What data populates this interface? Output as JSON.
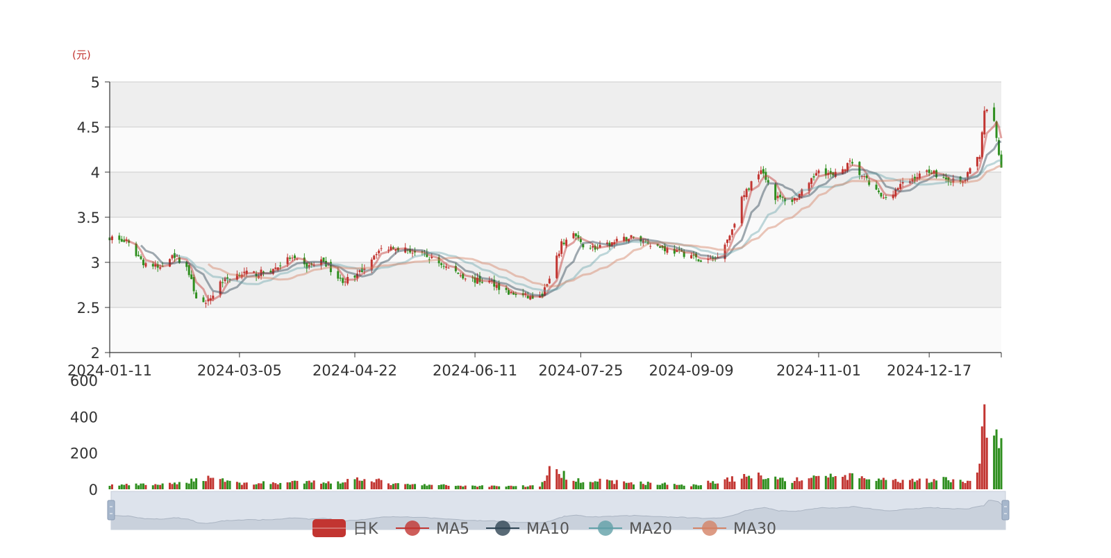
{
  "chart_data": [
    {
      "type": "candlestick",
      "title": "",
      "ylabel": "(元)",
      "ylim": [
        2,
        5
      ],
      "yticks": [
        "2",
        "2.5",
        "3",
        "3.5",
        "4",
        "4.5",
        "5"
      ],
      "xticks": [
        "2024-01-11",
        "2024-03-05",
        "2024-04-22",
        "2024-06-11",
        "2024-07-25",
        "2024-09-09",
        "2024-11-01",
        "2024-12-17"
      ],
      "xlim": [
        "2024-01-11",
        "2025-01-16"
      ],
      "grid": true,
      "colors": {
        "up": "#c23531",
        "down": "#2f8f1f",
        "ma5": "#c23531",
        "ma10": "#2f4554",
        "ma20": "#61a0a8",
        "ma30": "#d48265"
      },
      "close_path": [
        [
          "2024-01-11",
          3.28
        ],
        [
          "2024-01-18",
          3.22
        ],
        [
          "2024-01-25",
          3.0
        ],
        [
          "2024-02-01",
          2.93
        ],
        [
          "2024-02-06",
          3.1
        ],
        [
          "2024-02-12",
          2.95
        ],
        [
          "2024-02-16",
          2.62
        ],
        [
          "2024-02-20",
          2.52
        ],
        [
          "2024-02-26",
          2.78
        ],
        [
          "2024-03-05",
          2.88
        ],
        [
          "2024-03-12",
          2.87
        ],
        [
          "2024-03-19",
          2.92
        ],
        [
          "2024-03-26",
          3.05
        ],
        [
          "2024-04-02",
          2.95
        ],
        [
          "2024-04-09",
          3.02
        ],
        [
          "2024-04-16",
          2.8
        ],
        [
          "2024-04-22",
          2.82
        ],
        [
          "2024-04-26",
          2.95
        ],
        [
          "2024-05-01",
          3.12
        ],
        [
          "2024-05-08",
          3.18
        ],
        [
          "2024-05-16",
          3.12
        ],
        [
          "2024-05-23",
          3.05
        ],
        [
          "2024-05-30",
          2.95
        ],
        [
          "2024-06-06",
          2.85
        ],
        [
          "2024-06-11",
          2.8
        ],
        [
          "2024-06-18",
          2.78
        ],
        [
          "2024-06-25",
          2.66
        ],
        [
          "2024-07-02",
          2.62
        ],
        [
          "2024-07-08",
          2.6
        ],
        [
          "2024-07-12",
          2.8
        ],
        [
          "2024-07-17",
          3.2
        ],
        [
          "2024-07-22",
          3.32
        ],
        [
          "2024-07-25",
          3.2
        ],
        [
          "2024-08-01",
          3.15
        ],
        [
          "2024-08-08",
          3.22
        ],
        [
          "2024-08-15",
          3.28
        ],
        [
          "2024-08-22",
          3.22
        ],
        [
          "2024-08-29",
          3.15
        ],
        [
          "2024-09-05",
          3.1
        ],
        [
          "2024-09-09",
          3.08
        ],
        [
          "2024-09-13",
          3.0
        ],
        [
          "2024-09-19",
          3.05
        ],
        [
          "2024-09-25",
          3.3
        ],
        [
          "2024-09-30",
          3.7
        ],
        [
          "2024-10-08",
          4.05
        ],
        [
          "2024-10-14",
          3.72
        ],
        [
          "2024-10-21",
          3.68
        ],
        [
          "2024-10-28",
          3.85
        ],
        [
          "2024-11-01",
          4.05
        ],
        [
          "2024-11-07",
          3.95
        ],
        [
          "2024-11-14",
          4.1
        ],
        [
          "2024-11-21",
          3.9
        ],
        [
          "2024-11-28",
          3.7
        ],
        [
          "2024-12-05",
          3.85
        ],
        [
          "2024-12-12",
          3.95
        ],
        [
          "2024-12-17",
          4.02
        ],
        [
          "2024-12-24",
          3.92
        ],
        [
          "2024-12-31",
          3.88
        ],
        [
          "2025-01-07",
          4.2
        ],
        [
          "2025-01-09",
          4.7
        ],
        [
          "2025-01-13",
          4.55
        ],
        [
          "2025-01-16",
          4.02
        ]
      ]
    },
    {
      "type": "bar",
      "title": "",
      "ylim": [
        0,
        600
      ],
      "yticks": [
        "0",
        "200",
        "400",
        "600"
      ],
      "volume_path": [
        [
          "2024-01-11",
          25
        ],
        [
          "2024-02-06",
          30
        ],
        [
          "2024-02-23",
          75
        ],
        [
          "2024-03-05",
          35
        ],
        [
          "2024-04-16",
          45
        ],
        [
          "2024-04-26",
          70
        ],
        [
          "2024-05-08",
          30
        ],
        [
          "2024-06-11",
          20
        ],
        [
          "2024-07-08",
          20
        ],
        [
          "2024-07-12",
          110
        ],
        [
          "2024-07-25",
          55
        ],
        [
          "2024-08-15",
          40
        ],
        [
          "2024-09-09",
          25
        ],
        [
          "2024-09-25",
          60
        ],
        [
          "2024-10-08",
          85
        ],
        [
          "2024-10-21",
          50
        ],
        [
          "2024-11-01",
          80
        ],
        [
          "2024-11-14",
          75
        ],
        [
          "2024-12-05",
          45
        ],
        [
          "2024-12-24",
          60
        ],
        [
          "2025-01-02",
          40
        ],
        [
          "2025-01-06",
          100
        ],
        [
          "2025-01-09",
          450
        ],
        [
          "2025-01-13",
          330
        ],
        [
          "2025-01-16",
          265
        ]
      ]
    }
  ],
  "legend": {
    "items": [
      {
        "label": "日K",
        "color": "#c23531"
      },
      {
        "label": "MA5",
        "color": "#c23531"
      },
      {
        "label": "MA10",
        "color": "#2f4554"
      },
      {
        "label": "MA20",
        "color": "#61a0a8"
      },
      {
        "label": "MA30",
        "color": "#d48265"
      }
    ]
  }
}
